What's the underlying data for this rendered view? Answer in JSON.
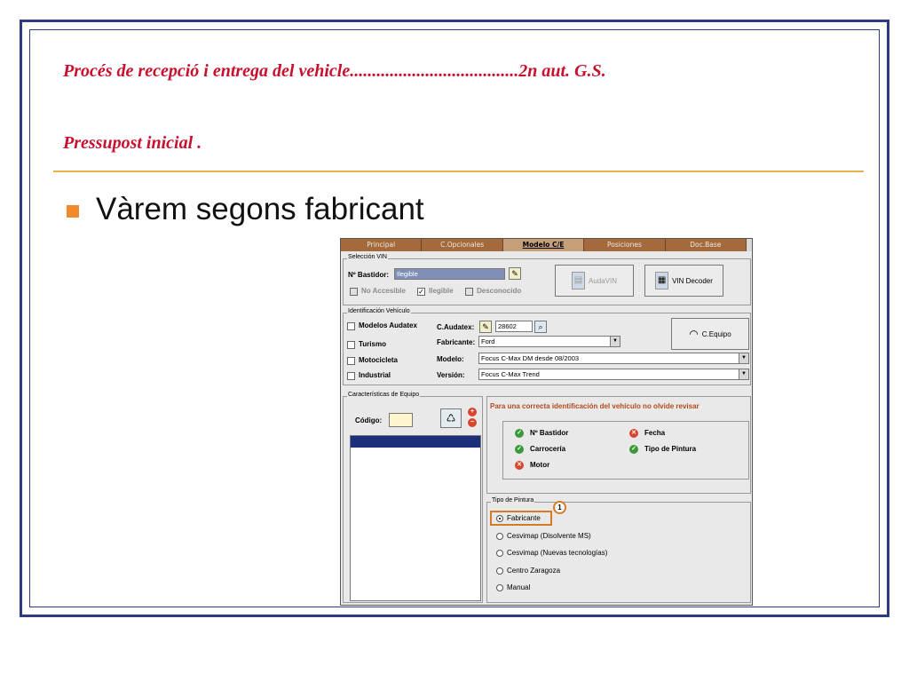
{
  "slide": {
    "title_line1": "Procés de recepció i entrega del vehicle......................................2n aut. G.S.",
    "title_line2": "Pressupost inicial .",
    "bullet": "Vàrem segons fabricant"
  },
  "app": {
    "tabs": [
      {
        "label": "Principal",
        "active": false
      },
      {
        "label": "C.Opcionales",
        "active": false
      },
      {
        "label": "Modelo C/E",
        "active": true
      },
      {
        "label": "Posiciones",
        "active": false
      },
      {
        "label": "Doc.Base",
        "active": false
      }
    ],
    "seleccion_vin": {
      "legend": "Selección VIN",
      "bastidor_label": "Nº Bastidor:",
      "bastidor_value": "Ilegible",
      "no_accesible": "No Accesible",
      "ilegible": "Ilegible",
      "desconocido": "Desconocido",
      "audavin_button": "AudaVIN",
      "vin_decoder_button": "VIN Decoder"
    },
    "identificacion": {
      "legend": "Identificación Vehículo",
      "modelos_audatex": "Modelos Audatex",
      "turismo": "Turismo",
      "motocicleta": "Motocicleta",
      "industrial": "Industrial",
      "c_audatex_label": "C.Audatex:",
      "c_audatex_value": "28602",
      "fabricante_label": "Fabricante:",
      "fabricante_value": "Ford",
      "modelo_label": "Modelo:",
      "modelo_value": "Focus C-Max DM desde 08/2003",
      "version_label": "Versión:",
      "version_value": "Focus C-Max Trend",
      "c_equipo_button": "C.Equipo"
    },
    "caracteristicas": {
      "legend": "Características de Equipo",
      "codigo_label": "Código:"
    },
    "revisar": {
      "warning": "Para una correcta identificación del vehículo no olvide revisar",
      "items": {
        "bastidor": "Nº Bastidor",
        "fecha": "Fecha",
        "carroceria": "Carrocería",
        "tipo_pintura": "Tipo de Pintura",
        "motor": "Motor"
      }
    },
    "pintura": {
      "legend": "Tipo de Pintura",
      "options": [
        "Fabricante",
        "Cesvimap (Disolvente MS)",
        "Cesvimap (Nuevas tecnologías)",
        "Centro Zaragoza",
        "Manual"
      ],
      "selected": "Fabricante",
      "callout": "1"
    }
  },
  "colors": {
    "title_red": "#c8102e",
    "frame_blue": "#2f3a84",
    "bullet_orange": "#f08a2c",
    "tab_brown": "#a26a3d"
  }
}
